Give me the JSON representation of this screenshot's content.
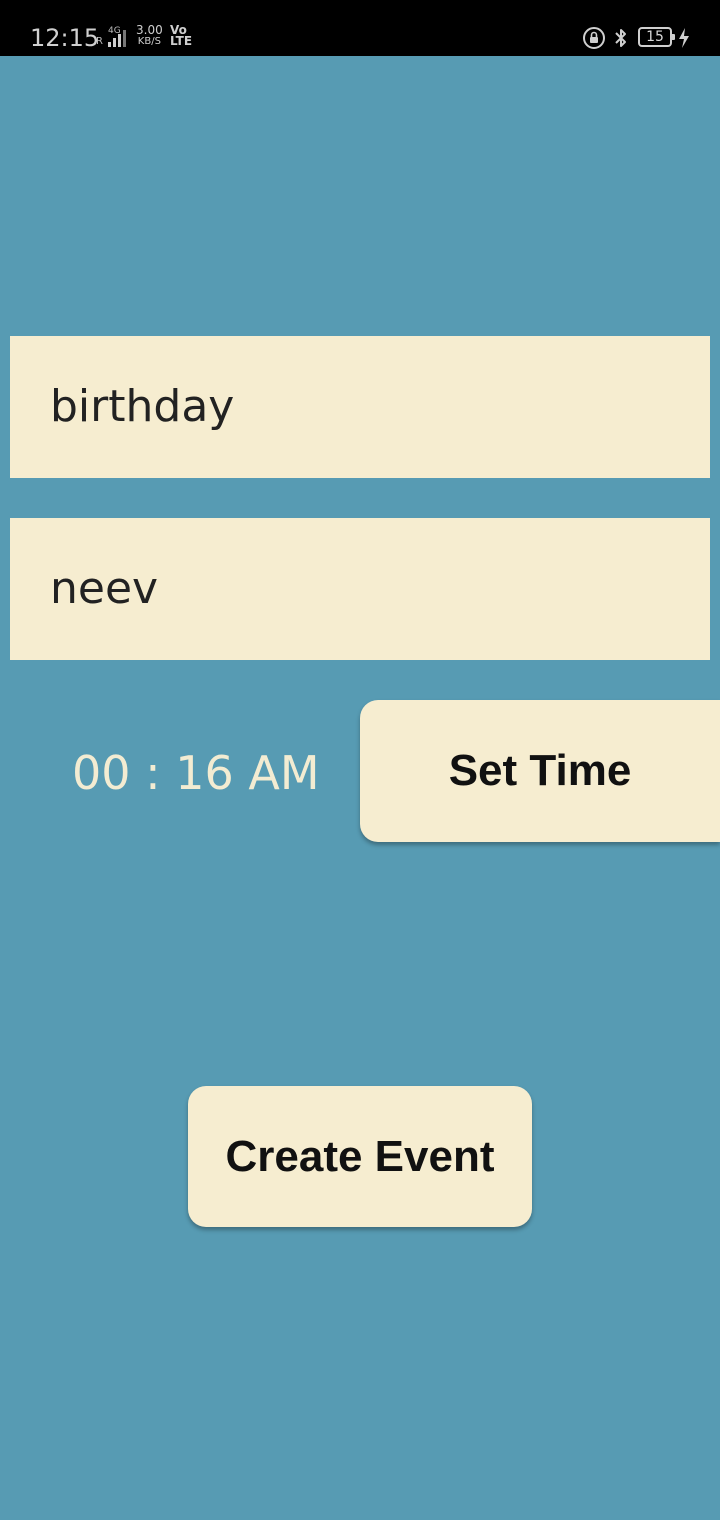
{
  "status_bar": {
    "time": "12:15",
    "network_type": "4G",
    "roaming": "R",
    "speed_value": "3.00",
    "speed_unit": "KB/S",
    "volte_top": "Vo",
    "volte_bottom": "LTE",
    "battery_level": "15",
    "icons": [
      "lock-rotation-icon",
      "bluetooth-icon",
      "battery-icon",
      "charging-icon"
    ]
  },
  "form": {
    "event_name_value": "birthday",
    "person_name_value": "neev",
    "time_display": "00 : 16 AM",
    "set_time_label": "Set Time",
    "create_event_label": "Create Event"
  },
  "colors": {
    "background": "#579bb3",
    "field_background": "#f6edd0",
    "time_text": "#f3ecd2"
  }
}
